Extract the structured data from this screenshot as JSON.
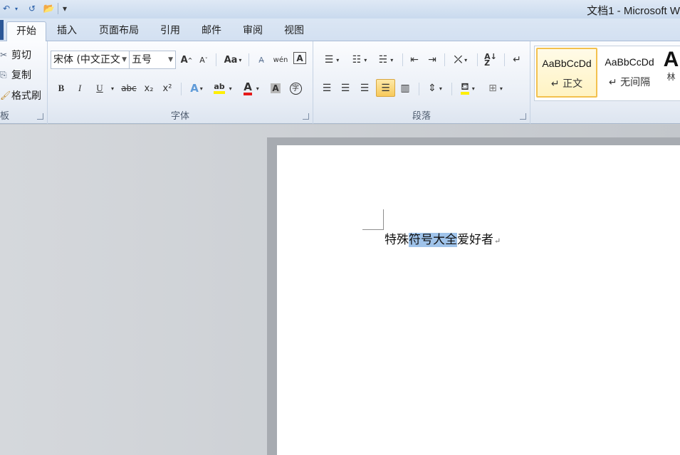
{
  "window": {
    "title": "文档1 - Microsoft W"
  },
  "qat": {
    "undo": "↶",
    "redo": "↺",
    "open": "📂",
    "more": "▾"
  },
  "tabs": [
    "开始",
    "插入",
    "页面布局",
    "引用",
    "邮件",
    "审阅",
    "视图"
  ],
  "clipboard": {
    "cut": "剪切",
    "copy": "复制",
    "painter": "格式刷",
    "label": "板"
  },
  "font": {
    "name": "宋体 (中文正文",
    "size": "五号",
    "label": "字体",
    "grow": "A",
    "shrink": "A",
    "case": "Aa",
    "bold": "B",
    "italic": "I",
    "underline": "U",
    "strike": "abc",
    "sub": "x₂",
    "sup": "x²",
    "effects": "A",
    "highlight": "ab",
    "color": "A",
    "shade": "A",
    "enclose": "字",
    "phonetic": "wén",
    "border": "A"
  },
  "paragraph": {
    "label": "段落"
  },
  "styles": [
    {
      "sample": "AaBbCcDd",
      "name": "↵ 正文"
    },
    {
      "sample": "AaBbCcDd",
      "name": "↵ 无间隔"
    },
    {
      "sample": "A",
      "name": "林"
    }
  ],
  "document": {
    "before": "特殊",
    "selected": "符号大全",
    "after": "爱好者",
    "mark": "↵"
  },
  "colors": {
    "accent": "#2b5797",
    "selection": "#9fc3ea",
    "ribbon_bg": "#e9eef6"
  }
}
